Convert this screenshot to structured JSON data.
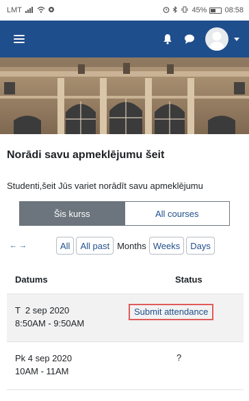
{
  "statusbar": {
    "carrier": "LMT",
    "right_text": "45%",
    "time": "08:58"
  },
  "colors": {
    "navbar": "#1f4e8c",
    "link": "#1f4e8c",
    "tab_active": "#6c757d",
    "highlight": "#e05a5a",
    "row_shade": "#f2f2f2"
  },
  "navbar": {
    "icons": [
      "menu-icon",
      "bell-icon",
      "chat-icon",
      "avatar",
      "caret-down-icon"
    ]
  },
  "page": {
    "title": "Norādi savu apmeklējumu šeit",
    "intro": "Studenti,šeit Jūs variet norādīt savu apmeklējumu"
  },
  "tabs": [
    {
      "label": "Šis kurss",
      "active": true
    },
    {
      "label": "All courses",
      "active": false
    }
  ],
  "filters": {
    "arrows": "← →",
    "all": "All",
    "all_past": "All past",
    "months": "Months",
    "weeks": "Weeks",
    "days": "Days"
  },
  "table": {
    "headers": {
      "date": "Datums",
      "status": "Status"
    },
    "rows": [
      {
        "date": "T  2 sep 2020",
        "time": "8:50AM - 9:50AM",
        "status": "Submit attendance"
      },
      {
        "date": "Pk 4 sep 2020",
        "time": "10AM - 11AM",
        "status": "?"
      }
    ]
  }
}
